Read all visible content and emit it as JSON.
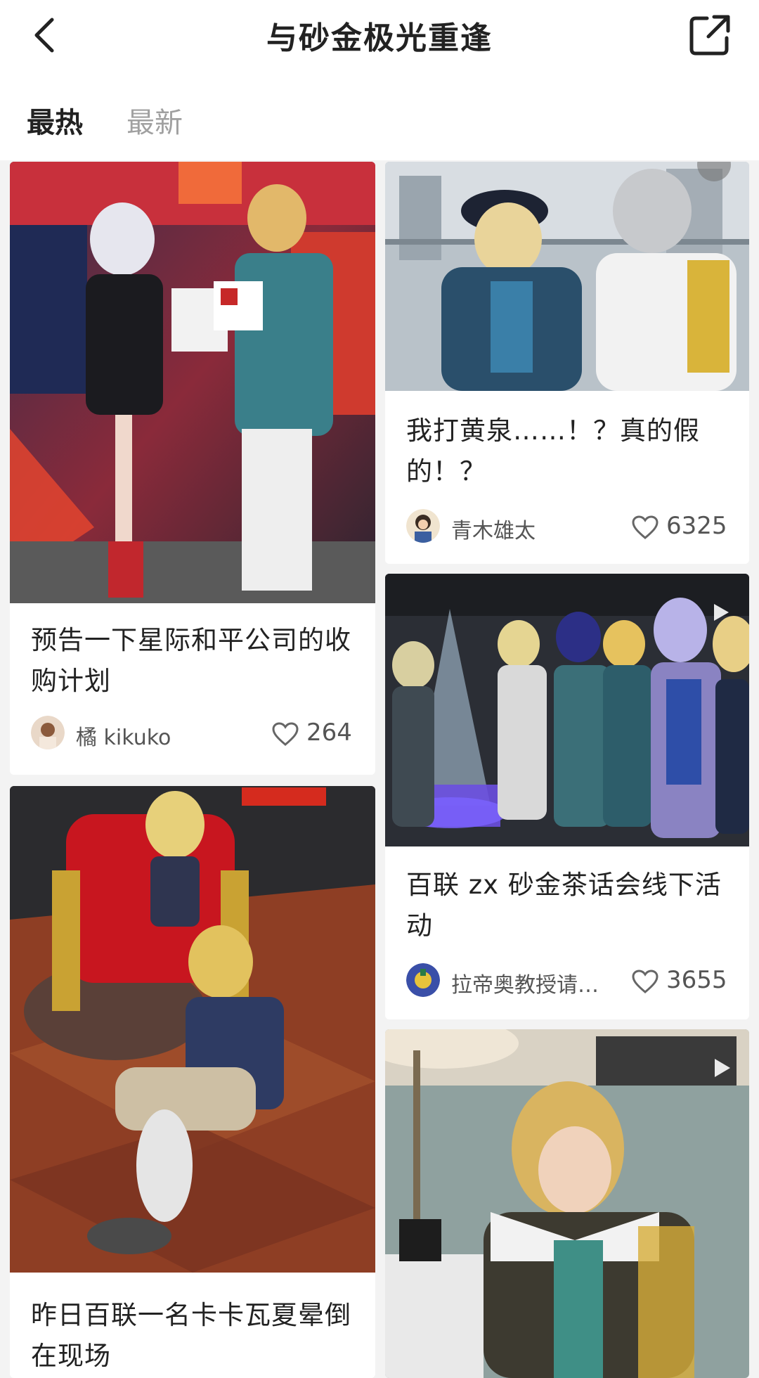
{
  "header": {
    "title": "与砂金极光重逢",
    "back_icon": "chevron-left-icon",
    "share_icon": "share-external-icon"
  },
  "tabs": [
    {
      "label": "最热",
      "active": true
    },
    {
      "label": "最新",
      "active": false
    }
  ],
  "posts": [
    {
      "title": "预告一下星际和平公司的收购计划",
      "author": "橘 kikuko",
      "likes": "264",
      "image": "two cosplayers posing at an event booth"
    },
    {
      "title": "我打黄泉……！？真的假的！？",
      "author": "青木雄太",
      "likes": "6325",
      "image": "two cosplayers on a balcony"
    },
    {
      "title": "百联 zx 砂金茶话会线下活动",
      "author": "拉帝奥教授请…",
      "likes": "3655",
      "image": "group of cosplayers around a champagne tower",
      "video": true
    },
    {
      "title": "昨日百联一名卡卡瓦夏晕倒在现场",
      "author": "",
      "likes": "",
      "image": "cosplayer sitting beside a red throne with a doll"
    },
    {
      "title": "",
      "author": "",
      "likes": "",
      "image": "blond cosplayer reclining in a chair",
      "video": true
    }
  ],
  "colors": {
    "accent": "#222222",
    "inactive_tab": "#a0a0a0",
    "background": "#f3f3f3",
    "meta_text": "#555555"
  }
}
